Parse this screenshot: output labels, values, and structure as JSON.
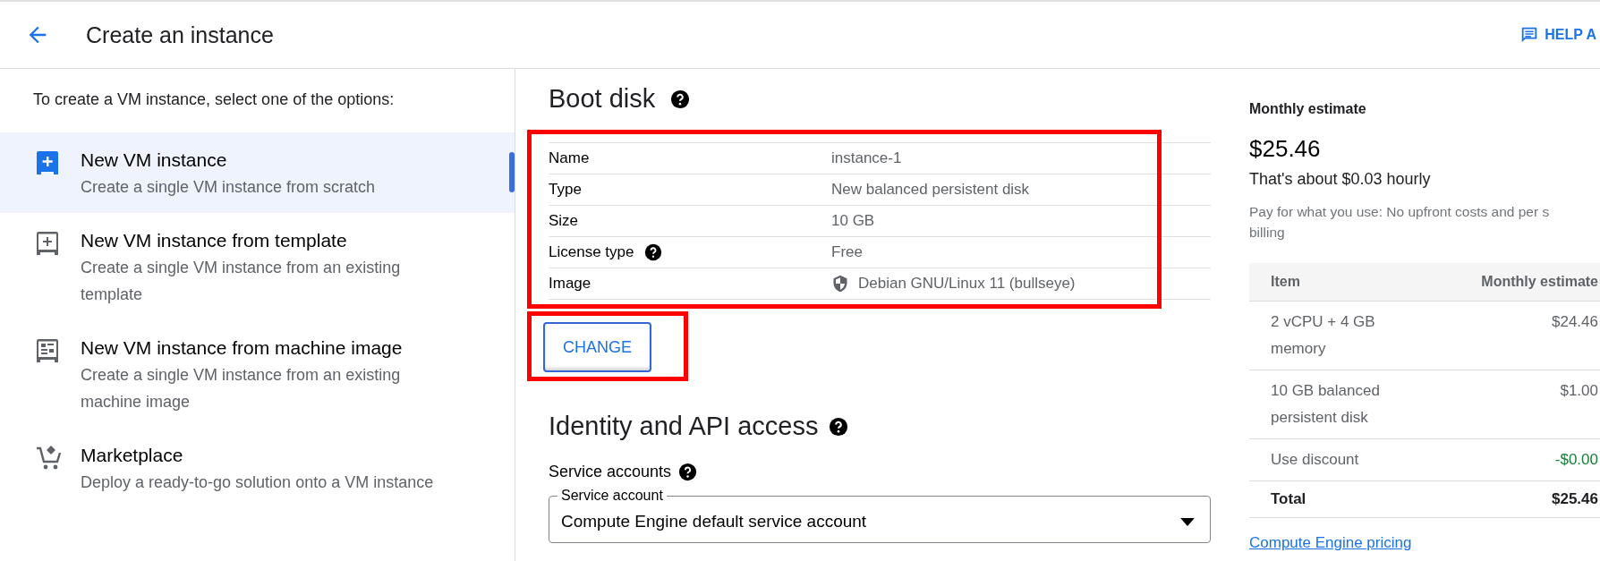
{
  "header": {
    "title": "Create an instance",
    "help_button": "HELP A"
  },
  "sidebar": {
    "intro": "To create a VM instance, select one of the options:",
    "items": [
      {
        "kind": "vm",
        "title": "New VM instance",
        "description": "Create a single VM instance from scratch",
        "selected": true
      },
      {
        "kind": "template",
        "title": "New VM instance from template",
        "description": "Create a single VM instance from an existing template",
        "selected": false
      },
      {
        "kind": "machine_image",
        "title": "New VM instance from machine image",
        "description": "Create a single VM instance from an existing machine image",
        "selected": false
      },
      {
        "kind": "marketplace",
        "title": "Marketplace",
        "description": "Deploy a ready-to-go solution onto a VM instance",
        "selected": false
      }
    ]
  },
  "boot_disk": {
    "title": "Boot disk",
    "rows": [
      {
        "label": "Name",
        "value": "instance-1",
        "help": false,
        "shield": false
      },
      {
        "label": "Type",
        "value": "New balanced persistent disk",
        "help": false,
        "shield": false
      },
      {
        "label": "Size",
        "value": "10 GB",
        "help": false,
        "shield": false
      },
      {
        "label": "License type",
        "value": "Free",
        "help": true,
        "shield": false
      },
      {
        "label": "Image",
        "value": "Debian GNU/Linux 11 (bullseye)",
        "help": false,
        "shield": true
      }
    ],
    "change_button": "CHANGE"
  },
  "identity": {
    "title": "Identity and API access",
    "service_accounts_label": "Service accounts",
    "field": {
      "label": "Service account",
      "value": "Compute Engine default service account"
    }
  },
  "estimate": {
    "title": "Monthly estimate",
    "total": "$25.46",
    "hourly": "That's about $0.03 hourly",
    "note": "Pay for what you use: No upfront costs and per s\nbilling",
    "columns": [
      "Item",
      "Monthly estimate"
    ],
    "rows": [
      {
        "kind": "item",
        "item": "2 vCPU + 4 GB memory",
        "cost": "$24.46"
      },
      {
        "kind": "item",
        "item": "10 GB balanced persistent disk",
        "cost": "$1.00"
      },
      {
        "kind": "discount",
        "item": "Use discount",
        "cost": "-$0.00"
      },
      {
        "kind": "total",
        "item": "Total",
        "cost": "$25.46"
      }
    ],
    "link": "Compute Engine pricing"
  }
}
